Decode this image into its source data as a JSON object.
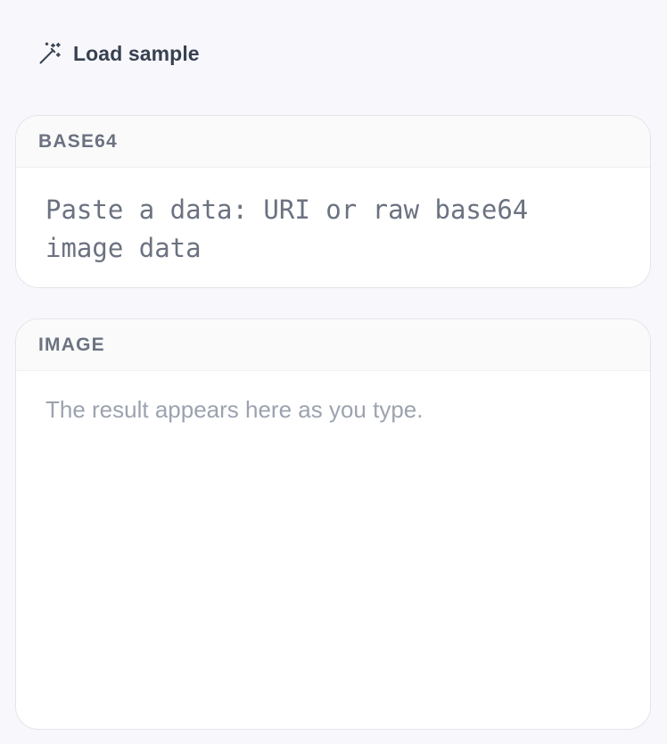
{
  "toolbar": {
    "load_sample_label": "Load sample",
    "load_sample_icon": "magic-wand-icon"
  },
  "input_panel": {
    "title": "BASE64",
    "value": "",
    "placeholder": "Paste a data: URI or raw base64 image data"
  },
  "output_panel": {
    "title": "IMAGE",
    "empty_message": "The result appears here as you type."
  }
}
